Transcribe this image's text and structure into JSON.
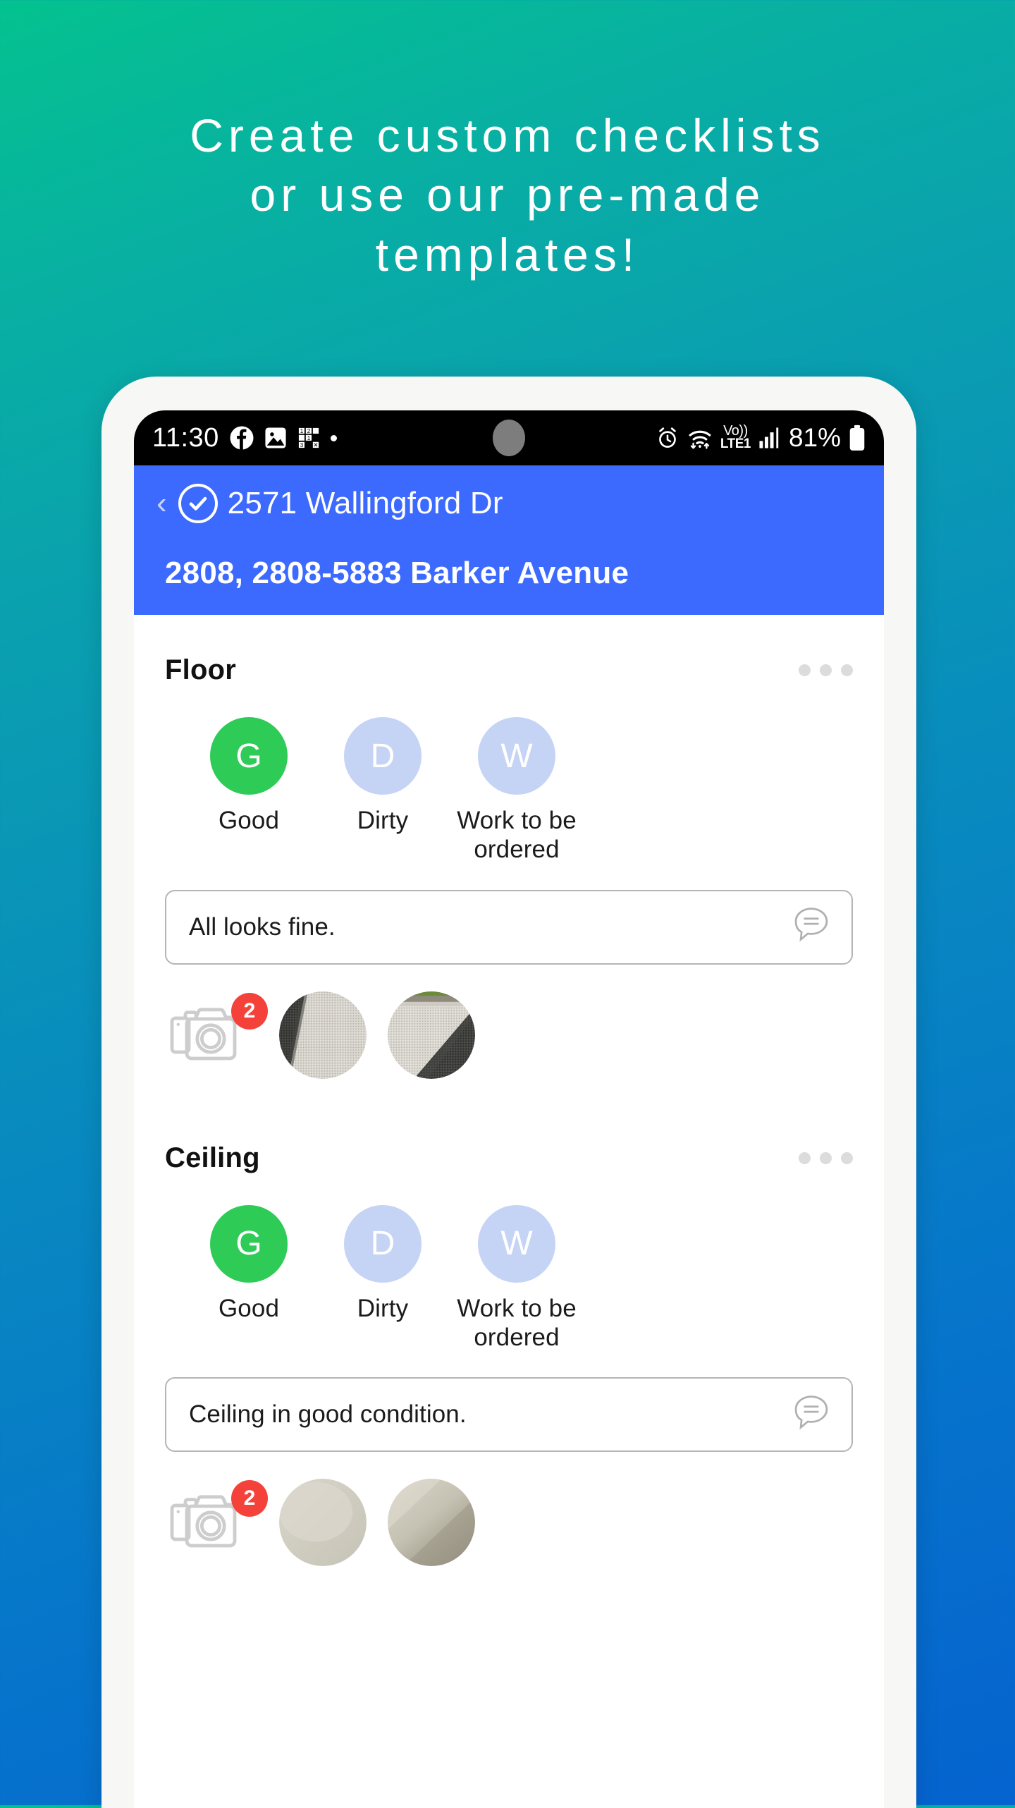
{
  "promo": {
    "headline": "Create custom checklists\nor use our pre-made\ntemplates!",
    "background_top_color": "#04c28f",
    "background_bottom_color": "#0563cf"
  },
  "statusbar": {
    "time": "11:30",
    "battery_percent": "81%",
    "network_label_top": "Vo))",
    "network_label_bottom": "LTE1",
    "icons": [
      "facebook-icon",
      "photos-icon",
      "puzzle-icon",
      "dot-icon",
      "alarm-icon",
      "wifi-icon",
      "volte-icon",
      "signal-icon",
      "battery-icon"
    ]
  },
  "header": {
    "accent_color": "#3d6afe",
    "back_label": "‹",
    "title": "2571 Wallingford Dr",
    "subtitle": "2808, 2808-5883 Barker Avenue"
  },
  "sections": [
    {
      "title": "Floor",
      "options": [
        {
          "letter": "G",
          "label": "Good",
          "selected": true
        },
        {
          "letter": "D",
          "label": "Dirty",
          "selected": false
        },
        {
          "letter": "W",
          "label": "Work to be ordered",
          "selected": false
        }
      ],
      "note": "All looks fine.",
      "photo_count": "2",
      "photos": [
        "pavement-split-photo",
        "pavement-diagonal-photo"
      ]
    },
    {
      "title": "Ceiling",
      "options": [
        {
          "letter": "G",
          "label": "Good",
          "selected": true
        },
        {
          "letter": "D",
          "label": "Dirty",
          "selected": false
        },
        {
          "letter": "W",
          "label": "Work to be ordered",
          "selected": false
        }
      ],
      "note": "Ceiling in good condition.",
      "photo_count": "2",
      "photos": [
        "ceiling-plain-photo",
        "ceiling-shaded-photo"
      ]
    }
  ],
  "colors": {
    "selected_green": "#2ecc57",
    "unselected_blue": "#c5d4f5",
    "badge_red": "#f4423a"
  }
}
